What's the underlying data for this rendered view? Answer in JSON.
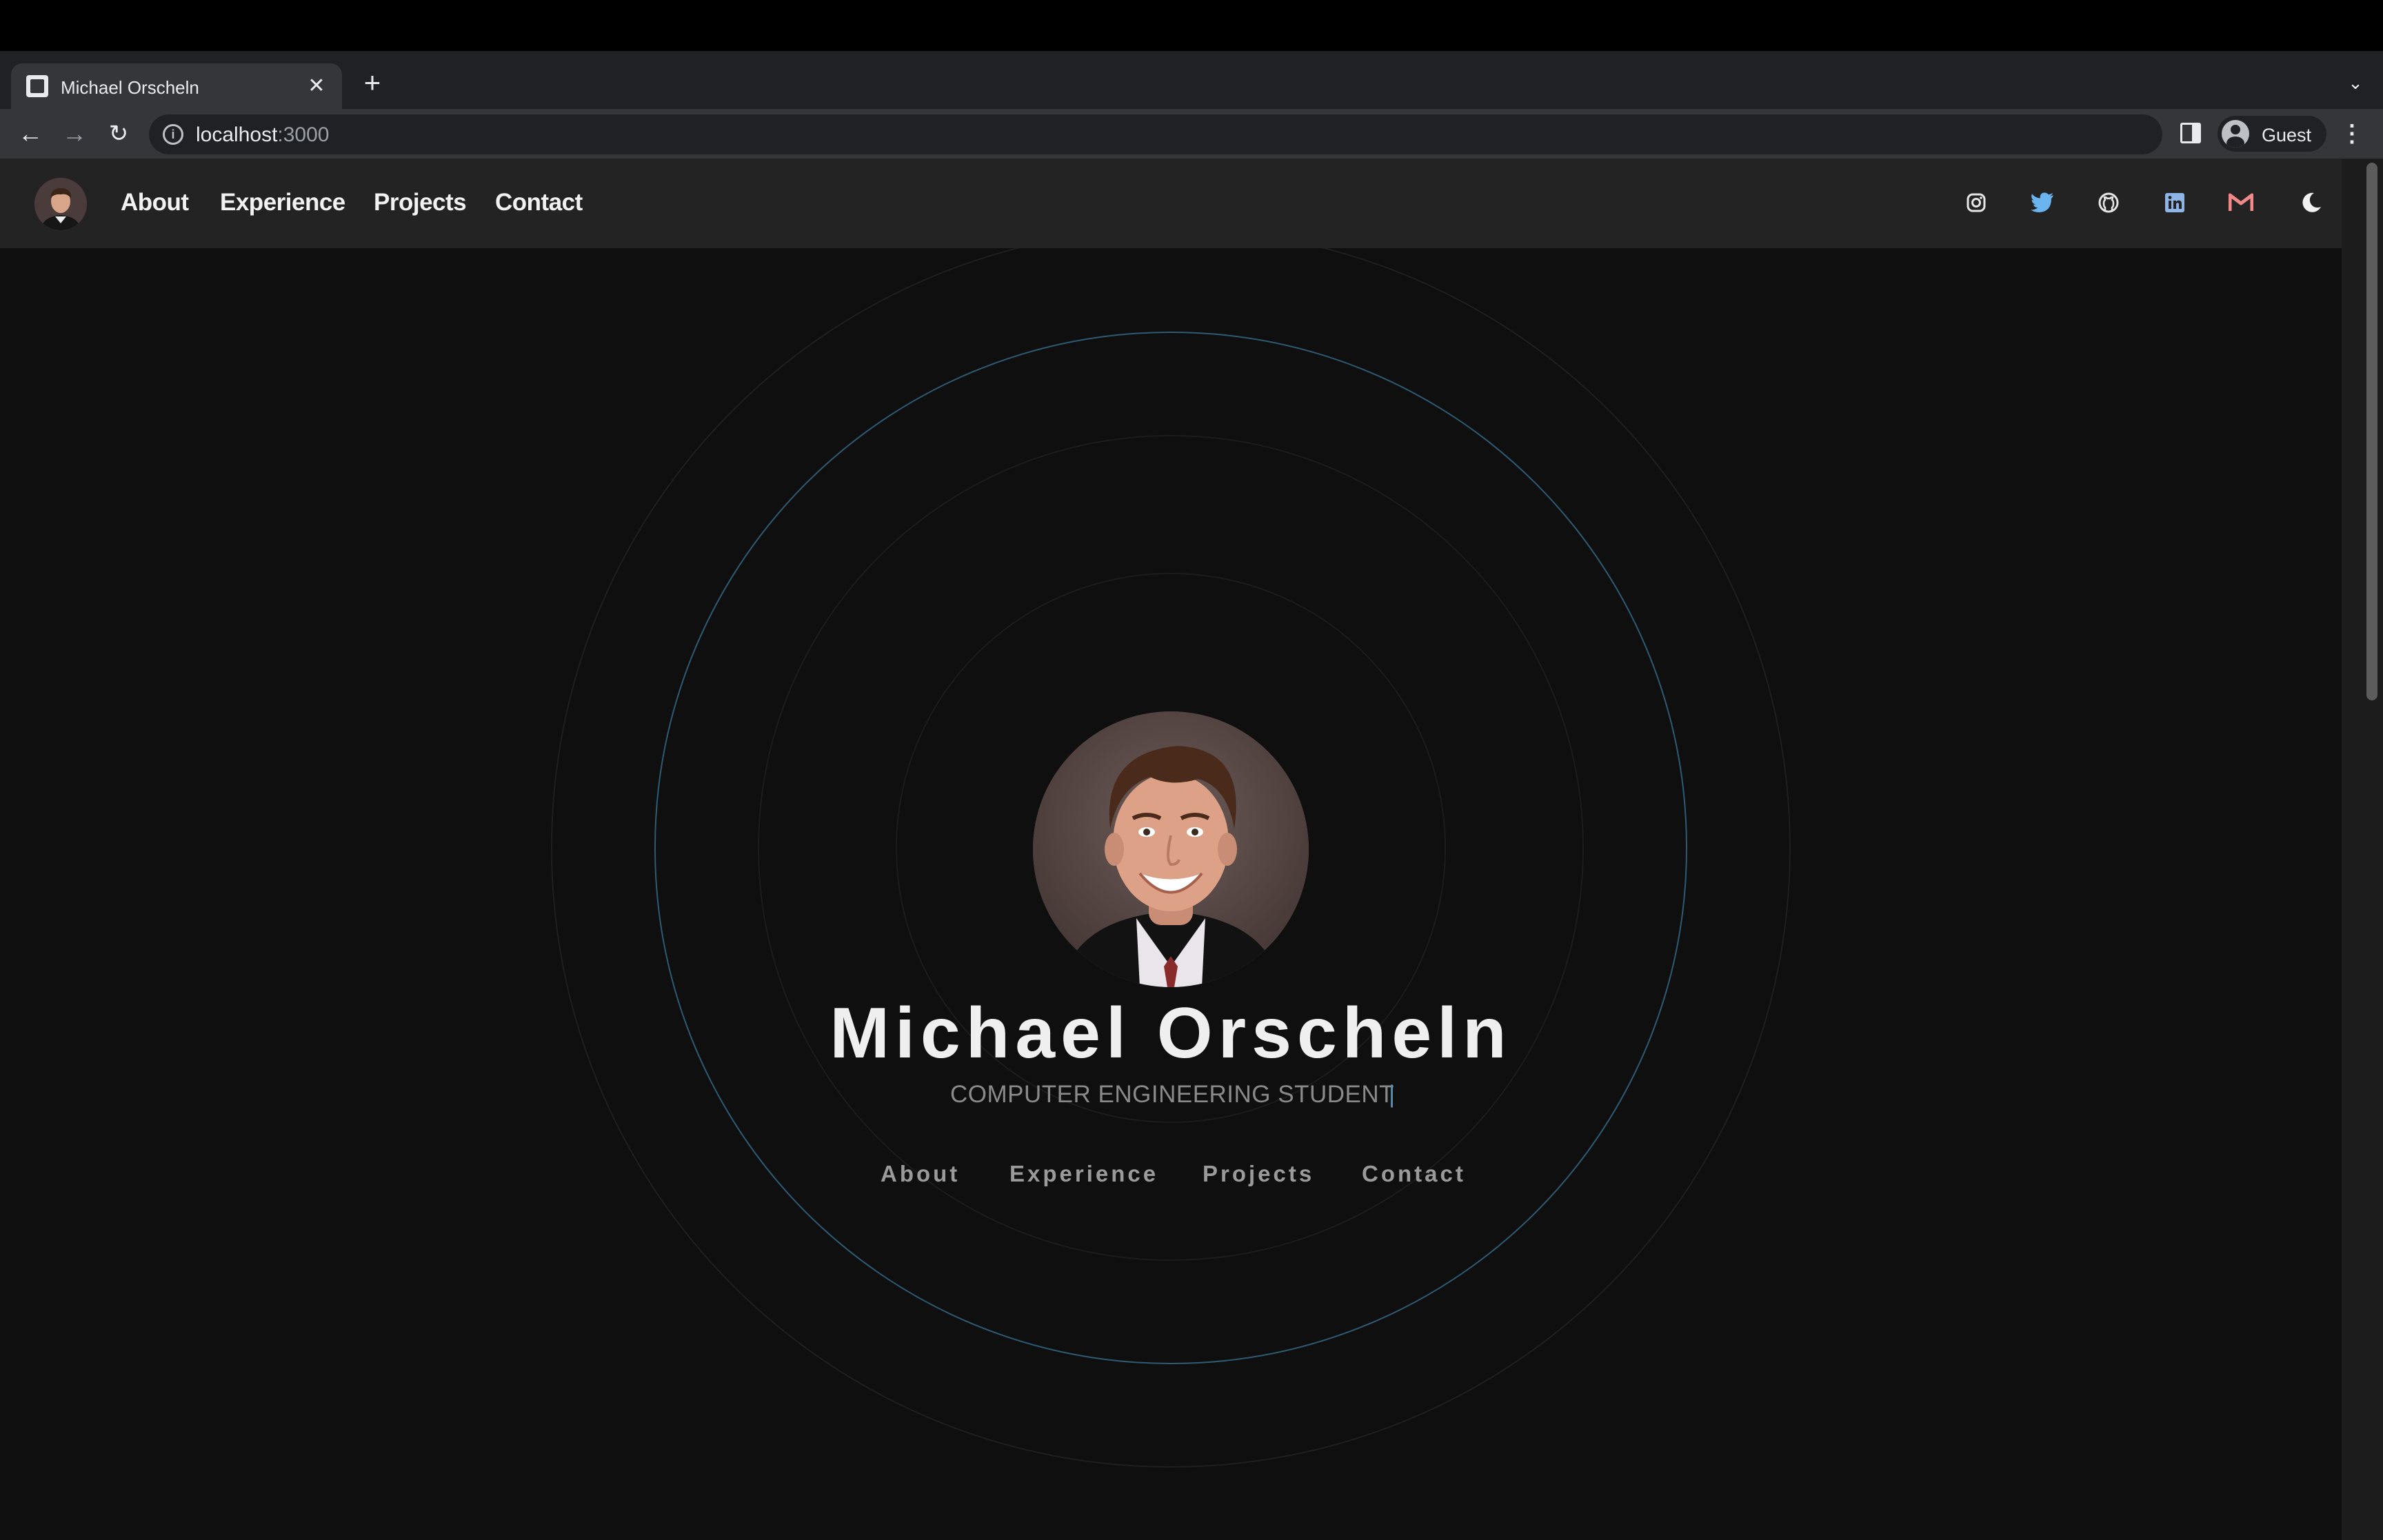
{
  "browser": {
    "tab_title": "Michael Orscheln",
    "url_host": "localhost",
    "url_port": ":3000",
    "profile_name": "Guest"
  },
  "site": {
    "nav": [
      "About",
      "Experience",
      "Projects",
      "Contact"
    ],
    "social_icons": [
      "instagram-icon",
      "twitter-icon",
      "github-icon",
      "linkedin-icon",
      "gmail-icon",
      "moon-icon"
    ],
    "colors": {
      "twitter": "#6ab4f0",
      "linkedin": "#8fb5e8",
      "gmail": "#f08a8a",
      "ring_accent": "#2e5a73"
    }
  },
  "hero": {
    "name": "Michael Orscheln",
    "subtitle": "COMPUTER ENGINEERING STUDENT",
    "cursor": "|",
    "links": [
      "About",
      "Experience",
      "Projects",
      "Contact"
    ]
  }
}
